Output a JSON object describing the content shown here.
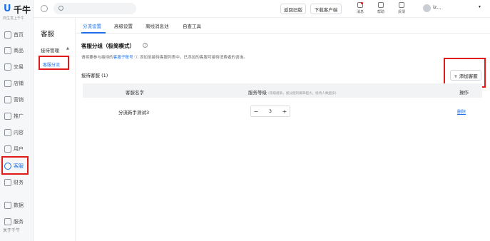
{
  "brand": {
    "logo_mark": "U",
    "name": "千牛",
    "slogan": "商生意上千牛"
  },
  "rail": {
    "items": [
      {
        "label": "首页",
        "icon": "home-icon"
      },
      {
        "label": "商品",
        "icon": "product-icon"
      },
      {
        "label": "交易",
        "icon": "trade-icon"
      },
      {
        "label": "店铺",
        "icon": "store-icon"
      },
      {
        "label": "营销",
        "icon": "marketing-icon"
      },
      {
        "label": "推广",
        "icon": "promotion-icon"
      },
      {
        "label": "内容",
        "icon": "content-icon"
      },
      {
        "label": "用户",
        "icon": "user-icon"
      },
      {
        "label": "客服",
        "icon": "headset-icon"
      },
      {
        "label": "财务",
        "icon": "finance-icon"
      },
      {
        "label": "数据",
        "icon": "data-icon"
      },
      {
        "label": "服务",
        "icon": "service-icon"
      }
    ],
    "active_index": 8,
    "footer": "关于千牛"
  },
  "topbar": {
    "search_placeholder": "",
    "back_old_label": "返回旧版",
    "download_label": "下载客户端",
    "messages_label": "消息",
    "help_label": "帮助",
    "feedback_label": "反馈",
    "user_name": "iz..."
  },
  "subnav": {
    "title": "客服",
    "group_label": "接待管理",
    "group_arrow": "▲",
    "item_label": "客服分流"
  },
  "tabs": [
    "分流设置",
    "高级设置",
    "离线消息池",
    "自查工具"
  ],
  "active_tab": 0,
  "section": {
    "title": "客服分组（极简模式）",
    "desc_prefix": "请将要参与接待的",
    "desc_link": "客服子账号",
    "desc_suffix": " ⓘ 添加至接待客服列表中，已添加的客服可接待消费者的咨询。"
  },
  "reception": {
    "title": "接待客服 (1)",
    "add_button": "+ 添加客服"
  },
  "table": {
    "headers": {
      "name": "客服名字",
      "level": "服务等级",
      "level_note": "(等级越高，被分配的概率越大，接待人数越多)",
      "action": "操作"
    },
    "rows": [
      {
        "name": "分流新手测试3",
        "level": "3",
        "action": "删除"
      }
    ]
  },
  "colors": {
    "accent": "#1c6fe8",
    "highlight": "#e01919"
  }
}
